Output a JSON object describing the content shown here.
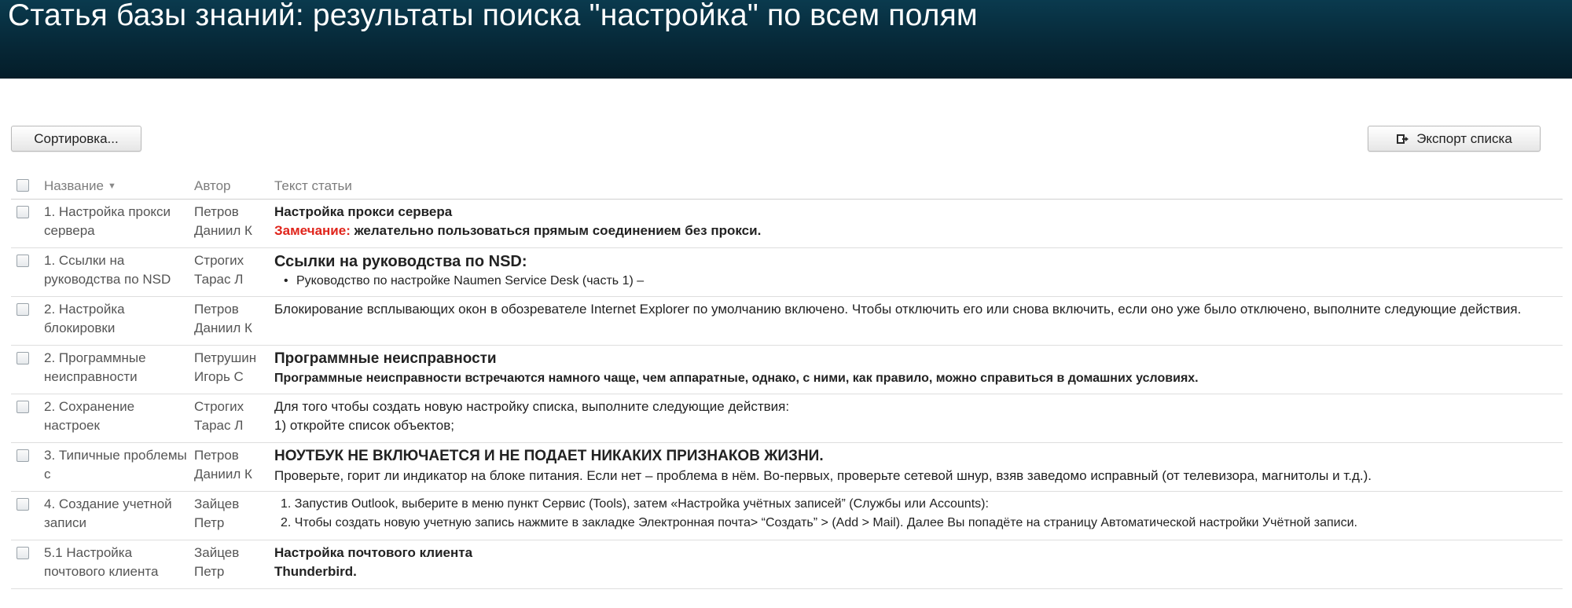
{
  "header": {
    "title": "Статья базы знаний: результаты поиска \"настройка\" по всем полям"
  },
  "toolbar": {
    "sort_label": "Сортировка...",
    "export_label": "Экспорт списка"
  },
  "table": {
    "columns": {
      "name": "Название",
      "author": "Автор",
      "text": "Текст статьи"
    },
    "rows": [
      {
        "name": "1. Настройка прокси сервера",
        "author": "Петров Даниил К",
        "title": "Настройка прокси сервера",
        "note_label": "Замечание:",
        "note_text": " желательно пользоваться прямым соединением без прокси."
      },
      {
        "name": "1. Ссылки на руководства по NSD",
        "author": "Строгих Тарас Л",
        "title": "Ссылки на руководства по NSD:",
        "bullet": "Руководство по настройке Naumen Service Desk (часть 1) –"
      },
      {
        "name": "2. Настройка блокировки",
        "author": "Петров Даниил К",
        "text": "Блокирование всплывающих окон в обозревателе Internet Explorer по умолчанию включено. Чтобы отключить его или снова включить, если оно уже было отключено, выполните следующие действия."
      },
      {
        "name": "2. Программные неисправности",
        "author": "Петрушин Игорь С",
        "title": "Программные неисправности",
        "text": "Программные неисправности встречаются намного чаще, чем аппаратные, однако, с ними, как правило, можно справиться в домашних условиях."
      },
      {
        "name": "2. Сохранение настроек",
        "author": "Строгих Тарас Л",
        "line1": "Для того чтобы создать новую настройку списка, выполните следующие действия:",
        "line2": "1) откройте список объектов;"
      },
      {
        "name": "3. Типичные проблемы с",
        "author": "Петров Даниил К",
        "title": "НОУТБУК НЕ ВКЛЮЧАЕТСЯ И НЕ ПОДАЕТ НИКАКИХ ПРИЗНАКОВ ЖИЗНИ.",
        "text": "Проверьте, горит ли индикатор на блоке питания. Если нет – проблема в нём. Во-первых, проверьте сетевой шнур, взяв заведомо исправный (от телевизора, магнитолы и т.д.)."
      },
      {
        "name": "4. Создание учетной записи",
        "author": "Зайцев Петр",
        "item1": "1.  Запустив Outlook, выберите в меню пункт Сервис (Tools), затем «Настройка учётных записей” (Службы или Accounts):",
        "item2": "2.  Чтобы создать новую учетную запись нажмите в закладке Электронная почта> “Создать” > (Add > Mail).  Далее Вы попадёте на страницу Автоматической настройки Учётной записи."
      },
      {
        "name": "5.1 Настройка почтового клиента",
        "author": "Зайцев Петр",
        "line1": "Настройка почтового клиента",
        "line2": "Thunderbird."
      }
    ]
  },
  "icons": {
    "checkbox": "checkbox-icon",
    "export": "export-icon",
    "sort": "sort-desc-icon"
  },
  "colors": {
    "header_bg": "#062736",
    "note_red": "#e0241b"
  }
}
